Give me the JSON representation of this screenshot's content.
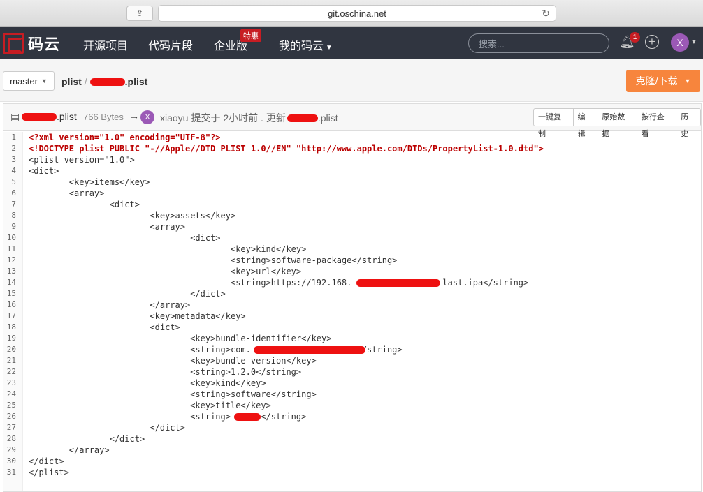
{
  "browser": {
    "url": "git.oschina.net"
  },
  "nav": {
    "logo": "码云",
    "items": [
      "开源项目",
      "代码片段",
      "企业版",
      "我的码云"
    ],
    "badge": "特惠",
    "search_placeholder": "搜索...",
    "notifications": "1",
    "avatar": "X"
  },
  "branch": {
    "name": "master",
    "path_root": "plist",
    "path_file": ".plist",
    "clone_label": "克隆/下载"
  },
  "file": {
    "name": ".plist",
    "size": "766 Bytes",
    "avatar": "X",
    "author": "xiaoyu",
    "commit_info": "提交于 2小时前 . 更新",
    "commit_file": ".plist",
    "tools": [
      "一键复制",
      "编辑",
      "原始数据",
      "按行查看",
      "历史"
    ]
  },
  "code_lines": [
    "<?xml version=\"1.0\" encoding=\"UTF-8\"?>",
    "<!DOCTYPE plist PUBLIC \"-//Apple//DTD PLIST 1.0//EN\" \"http://www.apple.com/DTDs/PropertyList-1.0.dtd\">",
    "<plist version=\"1.0\">",
    "<dict>",
    "        <key>items</key>",
    "        <array>",
    "                <dict>",
    "                        <key>assets</key>",
    "                        <array>",
    "                                <dict>",
    "                                        <key>kind</key>",
    "                                        <string>software-package</string>",
    "                                        <key>url</key>",
    "                                        <string>https://192.168.                  last.ipa</string>",
    "                                </dict>",
    "                        </array>",
    "                        <key>metadata</key>",
    "                        <dict>",
    "                                <key>bundle-identifier</key>",
    "                                <string>com.                     </string>",
    "                                <key>bundle-version</key>",
    "                                <string>1.2.0</string>",
    "                                <key>kind</key>",
    "                                <string>software</string>",
    "                                <key>title</key>",
    "                                <string>      </string>",
    "                        </dict>",
    "                </dict>",
    "        </array>",
    "</dict>",
    "</plist>"
  ]
}
